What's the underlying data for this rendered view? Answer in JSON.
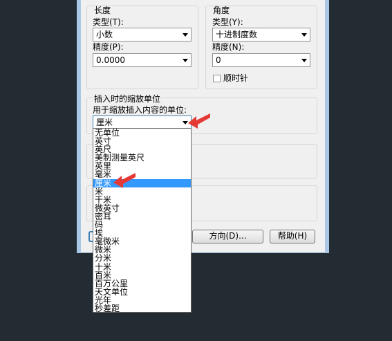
{
  "length": {
    "group_label": "长度",
    "type_label": "类型(T):",
    "type_value": "小数",
    "precision_label": "精度(P):",
    "precision_value": "0.0000"
  },
  "angle": {
    "group_label": "角度",
    "type_label": "类型(Y):",
    "type_value": "十进制度数",
    "precision_label": "精度(N):",
    "precision_value": "0",
    "clockwise_label": "顺时针"
  },
  "insert": {
    "group_label": "插入时的缩放单位",
    "desc_label": "用于缩放插入内容的单位:",
    "selected_value": "厘米",
    "options": [
      "无单位",
      "英寸",
      "英尺",
      "美制测量英尺",
      "英里",
      "毫米",
      "厘米",
      "米",
      "千米",
      "微英寸",
      "密耳",
      "码",
      "埃",
      "毫微米",
      "微米",
      "分米",
      "十米",
      "百米",
      "百万公里",
      "天文单位",
      "光年",
      "秒差距"
    ],
    "selected_index": 6
  },
  "buttons": {
    "direction": "方向(D)...",
    "help": "帮助(H)"
  },
  "colors": {
    "selection": "#3399ff",
    "pointer": "#e53935",
    "background": "#232b33"
  }
}
